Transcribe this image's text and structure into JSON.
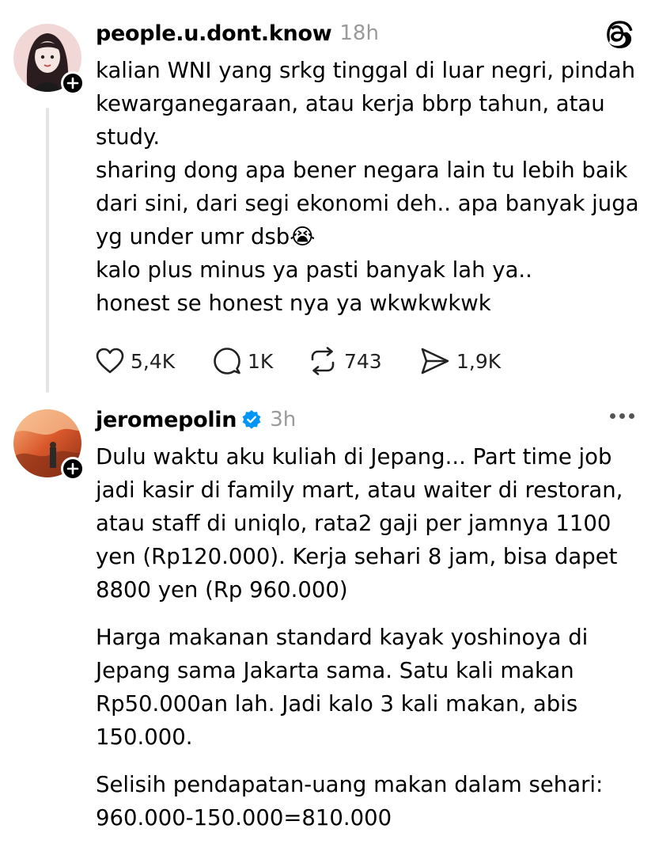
{
  "post1": {
    "username": "people.u.dont.know",
    "time": "18h",
    "paragraphs": [
      "kalian WNI yang srkg tinggal di luar negri, pindah kewarganegaraan, atau kerja bbrp tahun, atau study.",
      "sharing dong apa bener negara lain tu lebih baik dari sini, dari segi ekonomi deh.. apa banyak juga yg under umr dsb😭",
      "kalo plus minus ya pasti banyak lah ya..",
      "honest se honest nya ya wkwkwkwk"
    ],
    "likes": "5,4K",
    "replies": "1K",
    "reposts": "743",
    "shares": "1,9K"
  },
  "post2": {
    "username": "jeromepolin",
    "time": "3h",
    "paragraphs": [
      "Dulu waktu aku kuliah di Jepang... Part time job jadi kasir di family mart, atau waiter di restoran, atau staff di uniqlo, rata2 gaji per jamnya 1100 yen (Rp120.000). Kerja sehari 8 jam, bisa dapet 8800 yen (Rp 960.000)",
      "Harga makanan standard kayak yoshinoya di Jepang sama Jakarta sama. Satu kali makan Rp50.000an lah. Jadi kalo 3 kali makan, abis 150.000.",
      "Selisih pendapatan-uang makan dalam sehari: 960.000-150.000=810.000"
    ]
  },
  "icons": {
    "app_logo": "threads-icon",
    "like": "heart-icon",
    "reply": "comment-icon",
    "repost": "repost-icon",
    "share": "send-icon",
    "more": "more-icon",
    "verified": "verified-badge-icon",
    "follow": "plus-icon"
  },
  "colors": {
    "verified": "#0095f6",
    "muted_text": "#9a9a9a",
    "thread_line": "#e5e5e5"
  }
}
